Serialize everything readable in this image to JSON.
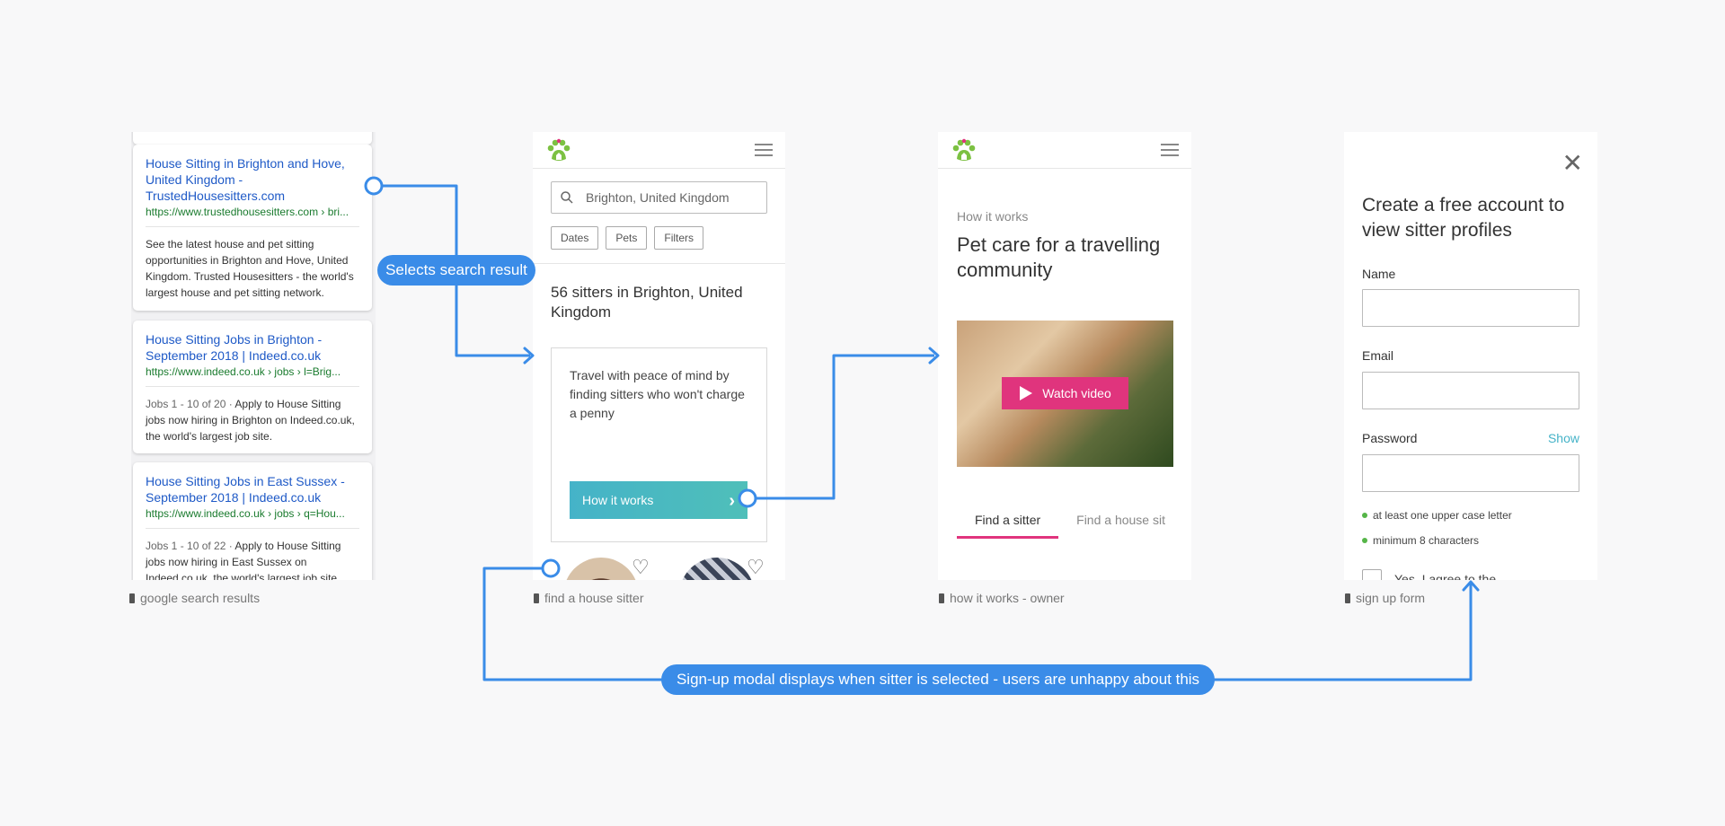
{
  "screens": {
    "google": {
      "caption": "google search results",
      "results": [
        {
          "title": "House Sitting in Brighton and Hove, United Kingdom - TrustedHousesitters.com",
          "url": "https://www.trustedhousesitters.com › bri...",
          "meta": "",
          "desc": "See the latest house and pet sitting opportunities in Brighton and Hove, United Kingdom. Trusted Housesitters - the world's largest house and pet sitting network."
        },
        {
          "title": "House Sitting Jobs in Brighton - September 2018 | Indeed.co.uk",
          "url": "https://www.indeed.co.uk › jobs › l=Brig...",
          "meta": "Jobs 1 - 10 of 20 · ",
          "desc": "Apply to House Sitting jobs now hiring in Brighton on Indeed.co.uk, the world's largest job site."
        },
        {
          "title": "House Sitting Jobs in East Sussex - September 2018 | Indeed.co.uk",
          "url": "https://www.indeed.co.uk › jobs › q=Hou...",
          "meta": "Jobs 1 - 10 of 22 · ",
          "desc": "Apply to House Sitting jobs now hiring in East Sussex on Indeed.co.uk, the world's largest job site."
        }
      ]
    },
    "search": {
      "caption": "find a house sitter",
      "search_value": "Brighton, United Kingdom",
      "filters": [
        "Dates",
        "Pets",
        "Filters"
      ],
      "results_count": "56 sitters in Brighton, United Kingdom",
      "promo_text": "Travel with peace of mind by finding sitters who won't charge a penny",
      "promo_button": "How it works"
    },
    "how_it_works": {
      "caption": "how it works - owner",
      "label": "How it works",
      "title": "Pet care for a travelling community",
      "video_button": "Watch video",
      "tabs": [
        "Find a sitter",
        "Find a house sit"
      ]
    },
    "signup": {
      "caption": "sign up form",
      "title": "Create a free account to view sitter profiles",
      "name_label": "Name",
      "email_label": "Email",
      "password_label": "Password",
      "show_label": "Show",
      "rules": [
        "at least one upper case letter",
        "minimum 8 characters"
      ],
      "agree_label": "Yes, I agree to the"
    }
  },
  "annotations": {
    "step1": "Selects search result",
    "step2": "Sign-up modal displays when sitter is selected - users are unhappy about this"
  },
  "colors": {
    "flow_blue": "#3a8ce8",
    "brand_pink": "#e0347d",
    "brand_teal": "#45b3c8",
    "link_blue": "#1f5ac7",
    "url_green": "#1a7b2e"
  }
}
